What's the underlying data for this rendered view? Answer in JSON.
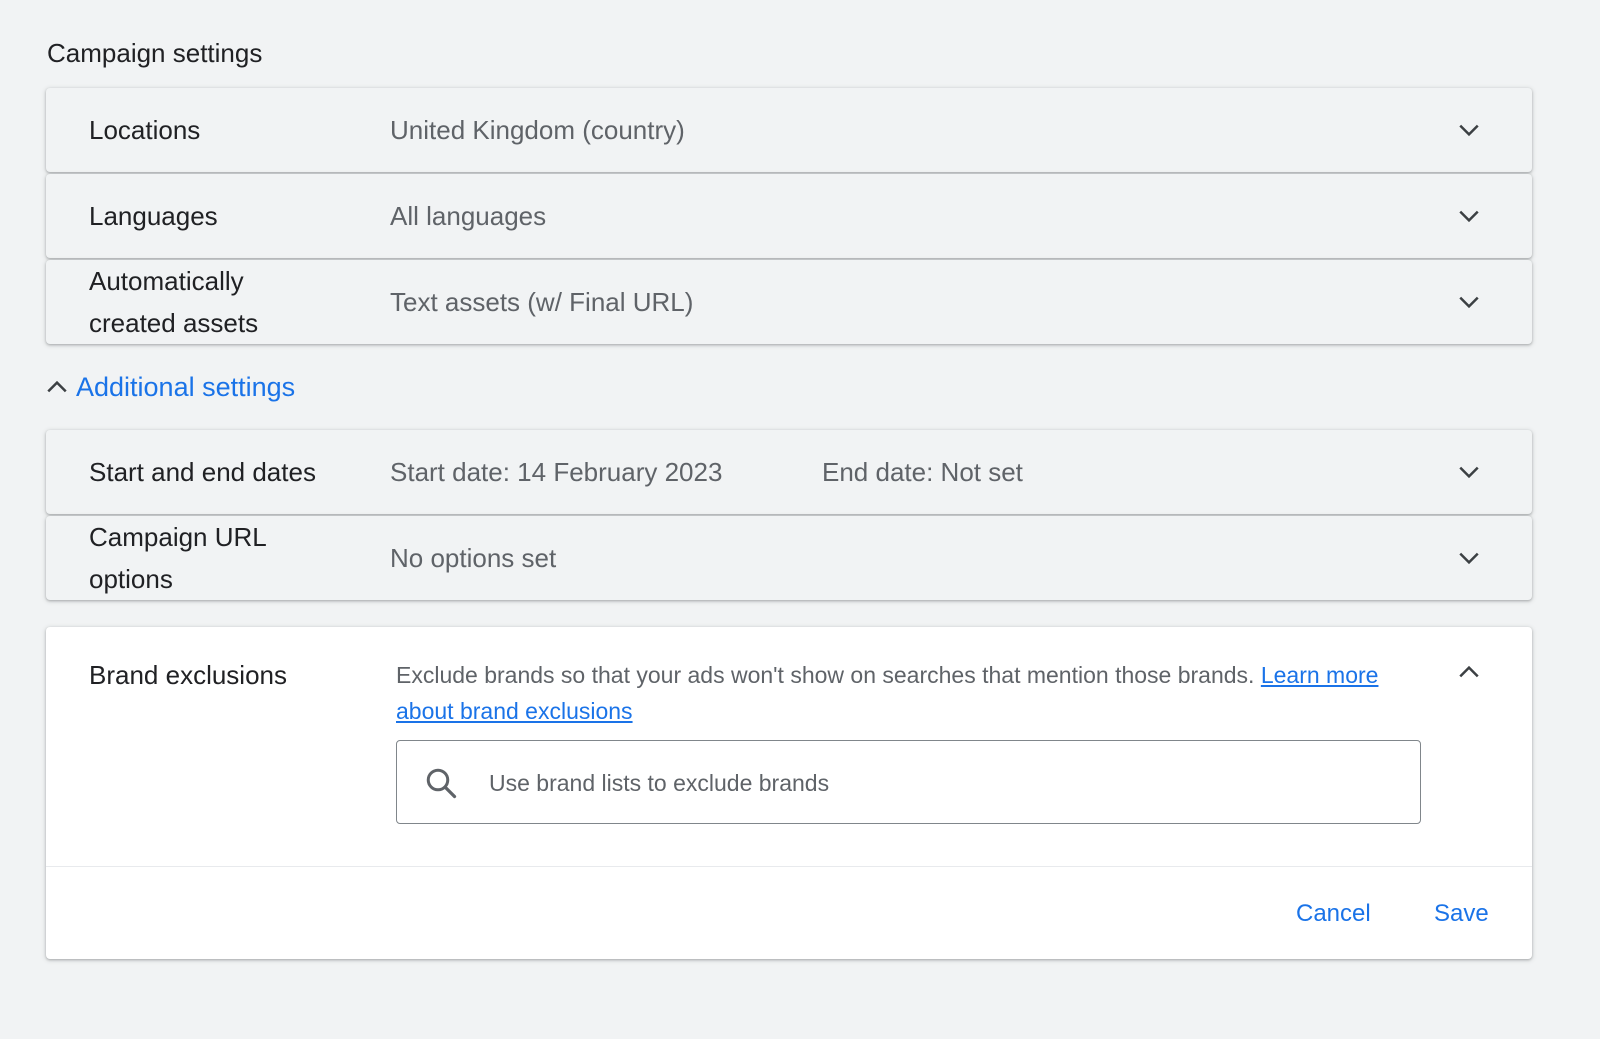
{
  "section_title": "Campaign settings",
  "rows_top": [
    {
      "label": "Locations",
      "value": "United Kingdom (country)"
    },
    {
      "label": "Languages",
      "value": "All languages"
    },
    {
      "label_line1": "Automatically",
      "label_line2": "created assets",
      "value": "Text assets (w/ Final URL)"
    }
  ],
  "additional_settings": {
    "label": "Additional settings"
  },
  "rows_additional": [
    {
      "label": "Start and end dates",
      "value": "Start date: 14 February 2023",
      "value2": "End date: Not set"
    },
    {
      "label_line1": "Campaign URL",
      "label_line2": "options",
      "value": "No options set"
    }
  ],
  "brand_exclusions": {
    "label": "Brand exclusions",
    "description": "Exclude brands so that your ads won't show on searches that mention those brands.",
    "link_text": "Learn more about brand exclusions",
    "search_placeholder": "Use brand lists to exclude brands",
    "search_value": "",
    "cancel_label": "Cancel",
    "save_label": "Save"
  },
  "colors": {
    "background": "#f1f3f4",
    "accent": "#1a73e8",
    "text_primary": "#202124",
    "text_secondary": "#5f6368"
  },
  "icons": {
    "row_expand": "chevron-down-icon",
    "row_collapse": "chevron-up-icon",
    "search": "search-icon"
  }
}
